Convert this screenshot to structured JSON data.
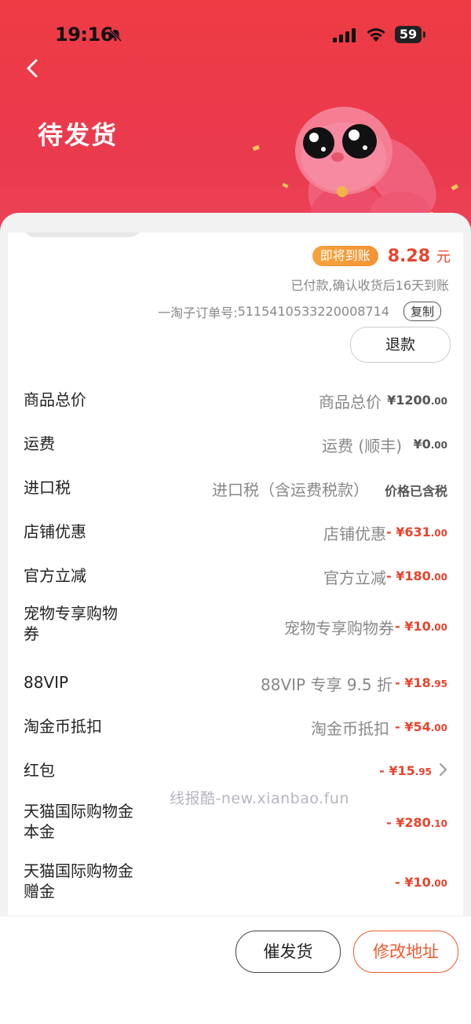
{
  "status_bar": {
    "time": "19:16",
    "battery": "59"
  },
  "header": {
    "title": "待发货"
  },
  "settlement": {
    "badge": "即将到账",
    "amount": "8.28",
    "unit": "元",
    "note": "已付款,确认收货后16天到账",
    "order_label": "一淘子订单号: ",
    "order_number": "5115410533220008714",
    "copy_label": "复制",
    "refund_label": "退款"
  },
  "price_rows": [
    {
      "label": "商品总价",
      "desc": "商品总价",
      "value_main": "¥1200",
      "value_dec": ".00"
    },
    {
      "label": "运费",
      "desc": "运费 (顺丰)",
      "value_main": "¥0",
      "value_dec": ".00"
    },
    {
      "label": "进口税",
      "desc": "进口税（含运费税款）",
      "value_main": "价格已含税",
      "value_dec": ""
    },
    {
      "label": "店铺优惠",
      "desc": "店铺优惠",
      "value_main": "- ¥631",
      "value_dec": ".00"
    },
    {
      "label": "官方立减",
      "desc": "官方立减",
      "value_main": "- ¥180",
      "value_dec": ".00"
    },
    {
      "label": "宠物专享购物券",
      "desc": "宠物专享购物券",
      "value_main": "- ¥10",
      "value_dec": ".00"
    },
    {
      "label": "88VIP",
      "desc": "88VIP 专享 9.5 折",
      "value_main": "- ¥18",
      "value_dec": ".95"
    },
    {
      "label": "淘金币抵扣",
      "desc": "淘金币抵扣",
      "value_main": "- ¥54",
      "value_dec": ".00"
    },
    {
      "label": "红包",
      "desc": "",
      "value_main": "- ¥15",
      "value_dec": ".95"
    },
    {
      "label": "天猫国际购物金本金",
      "desc": "",
      "value_main": "- ¥280",
      "value_dec": ".10"
    },
    {
      "label": "天猫国际购物金赠金",
      "desc": "",
      "value_main": "- ¥10",
      "value_dec": ".00"
    }
  ],
  "watermark": "线报酷-new.xianbao.fun",
  "bottom_bar": {
    "urge_label": "催发货",
    "address_label": "修改地址"
  },
  "colors": {
    "header_red": "#ea3a4f",
    "accent_red": "#e8442e",
    "badge_orange": "#f39335",
    "button_orange": "#ee5a2e"
  },
  "icons": [
    "bell-slash-icon",
    "signal-icon",
    "wifi-icon",
    "battery-icon",
    "back-arrow-icon",
    "chevron-right-icon"
  ]
}
